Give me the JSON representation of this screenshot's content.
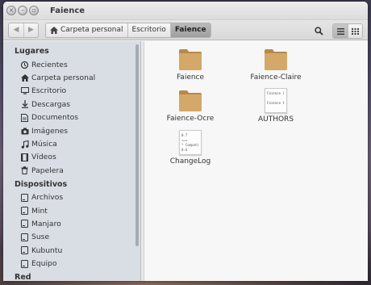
{
  "window": {
    "title": "Faience",
    "controls": [
      "close-icon",
      "minimize-icon",
      "maximize-icon"
    ]
  },
  "toolbar": {
    "back_icon": "arrow-left-icon",
    "forward_icon": "arrow-right-icon",
    "breadcrumbs": [
      {
        "label": "Carpeta personal",
        "icon": "home-icon",
        "active": false
      },
      {
        "label": "Escritorio",
        "active": false
      },
      {
        "label": "Faience",
        "active": true
      }
    ],
    "search_icon": "search-icon",
    "view_modes": [
      {
        "icon": "list-view-icon",
        "selected": true
      },
      {
        "icon": "grid-view-icon",
        "selected": false
      }
    ]
  },
  "sidebar": {
    "sections": [
      {
        "header": "Lugares",
        "items": [
          {
            "label": "Recientes",
            "icon": "recent-icon"
          },
          {
            "label": "Carpeta personal",
            "icon": "home-icon"
          },
          {
            "label": "Escritorio",
            "icon": "desktop-icon"
          },
          {
            "label": "Descargas",
            "icon": "download-icon"
          },
          {
            "label": "Documentos",
            "icon": "document-icon"
          },
          {
            "label": "Imágenes",
            "icon": "camera-icon"
          },
          {
            "label": "Música",
            "icon": "music-icon"
          },
          {
            "label": "Vídeos",
            "icon": "video-icon"
          },
          {
            "label": "Papelera",
            "icon": "trash-icon"
          }
        ]
      },
      {
        "header": "Dispositivos",
        "items": [
          {
            "label": "Archivos",
            "icon": "drive-icon"
          },
          {
            "label": "Mint",
            "icon": "drive-icon"
          },
          {
            "label": "Manjaro",
            "icon": "drive-icon"
          },
          {
            "label": "Suse",
            "icon": "drive-icon"
          },
          {
            "label": "Kubuntu",
            "icon": "drive-icon"
          },
          {
            "label": "Equipo",
            "icon": "drive-icon"
          }
        ]
      },
      {
        "header": "Red",
        "items": []
      }
    ]
  },
  "files": [
    {
      "name": "Faience",
      "type": "folder"
    },
    {
      "name": "Faience-Claire",
      "type": "folder"
    },
    {
      "name": "Faience-Ocre",
      "type": "folder"
    },
    {
      "name": "AUTHORS",
      "type": "text",
      "preview": [
        "Faience i",
        "",
        "Faience t"
      ]
    },
    {
      "name": "ChangeLog",
      "type": "text",
      "preview": [
        "0.7",
        "===",
        "* Compati",
        "0.6"
      ]
    }
  ],
  "colors": {
    "sidebar_bg": "#d9dee5",
    "folder": "#c99c5b",
    "active_crumb": "#a9a9a9"
  }
}
